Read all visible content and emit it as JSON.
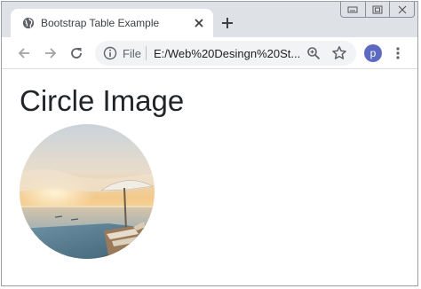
{
  "browser": {
    "tab_title": "Bootstrap Table Example",
    "url_scheme_label": "File",
    "url": "E:/Web%20Desingn%20St...",
    "profile_initial": "p",
    "colors": {
      "tab_strip": "#dee1e6",
      "omnibox": "#f1f3f4",
      "avatar": "#5c6bc0",
      "icon": "#5f6368"
    },
    "icons": {
      "favicon": "globe-icon",
      "tab_close": "close-icon",
      "new_tab": "plus-icon",
      "back": "back-arrow-icon",
      "forward": "forward-arrow-icon",
      "reload": "reload-icon",
      "site_info": "info-icon",
      "zoom": "zoom-icon",
      "bookmark": "star-icon",
      "menu": "kebab-menu-icon",
      "window_minimize": "minimize-icon",
      "window_restore": "restore-icon",
      "window_close": "close-icon"
    }
  },
  "page": {
    "heading": "Circle Image",
    "image": {
      "shape": "circle",
      "subject": "beach-umbrella-seascape-photo"
    }
  }
}
